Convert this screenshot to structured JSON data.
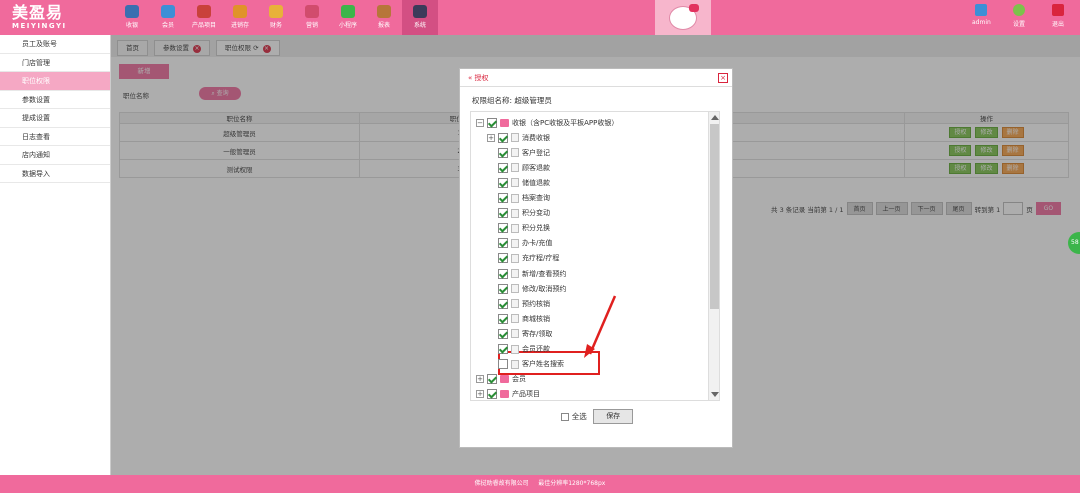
{
  "header": {
    "logo_cn": "美盈易",
    "logo_en": "MEIYINGYI",
    "nav": [
      {
        "label": "收银",
        "icon": "cashier-icon",
        "color": "#3a6fb0"
      },
      {
        "label": "会员",
        "icon": "member-icon",
        "color": "#3d8fd6"
      },
      {
        "label": "产品项目",
        "icon": "product-icon",
        "color": "#c9413b"
      },
      {
        "label": "进销存",
        "icon": "inventory-icon",
        "color": "#e0932a"
      },
      {
        "label": "财务",
        "icon": "finance-icon",
        "color": "#e8b23a"
      },
      {
        "label": "营销",
        "icon": "marketing-icon",
        "color": "#d14c6d"
      },
      {
        "label": "小程序",
        "icon": "miniprogram-icon",
        "color": "#3cb54a"
      },
      {
        "label": "报表",
        "icon": "report-icon",
        "color": "#b7763a"
      },
      {
        "label": "系统",
        "icon": "system-icon",
        "color": "#3b3b5a"
      }
    ],
    "user_label": "admin",
    "settings_label": "设置",
    "logout_label": "退出"
  },
  "sidebar": {
    "items": [
      {
        "label": "员工及账号",
        "active": false
      },
      {
        "label": "门店管理",
        "active": false
      },
      {
        "label": "职位权限",
        "active": true
      },
      {
        "label": "参数设置",
        "active": false
      },
      {
        "label": "提成设置",
        "active": false
      },
      {
        "label": "日志查看",
        "active": false
      },
      {
        "label": "店内通知",
        "active": false
      },
      {
        "label": "数据导入",
        "active": false
      }
    ]
  },
  "tabs": [
    {
      "label": "首页"
    },
    {
      "label": "参数设置"
    },
    {
      "label": "职位权限"
    }
  ],
  "main": {
    "add_button": "新增",
    "filter_label": "职位名称",
    "query_button": "查询",
    "table": {
      "headers": [
        "职位名称",
        "职位排",
        "操作"
      ],
      "rows": [
        [
          "超级管理员",
          "1"
        ],
        [
          "一般管理员",
          "2"
        ],
        [
          "测试权限",
          "3"
        ]
      ],
      "op_auth": "授权",
      "op_edit": "修改",
      "op_delete": "删除"
    },
    "pager": {
      "summary": "共 3 条记录 当前第 1 / 1",
      "first": "首页",
      "prev": "上一页",
      "next": "下一页",
      "last": "尾页",
      "goto_label": "转到第 1",
      "page_unit": "页",
      "go": "GO"
    }
  },
  "dialog": {
    "title": "« 授权",
    "group_line": "权限组名称: 超级管理员",
    "tree": [
      {
        "label": "收银（含PC收银及平板APP收银）",
        "level": 0,
        "checked": true,
        "expander": "−",
        "icon": "home"
      },
      {
        "label": "消费收银",
        "level": 1,
        "checked": true,
        "expander": "+",
        "icon": "file"
      },
      {
        "label": "客户登记",
        "level": 2,
        "checked": true,
        "expander": "",
        "icon": "file"
      },
      {
        "label": "顾客退款",
        "level": 2,
        "checked": true,
        "expander": "",
        "icon": "file"
      },
      {
        "label": "储值退款",
        "level": 2,
        "checked": true,
        "expander": "",
        "icon": "file"
      },
      {
        "label": "档案查询",
        "level": 2,
        "checked": true,
        "expander": "",
        "icon": "file"
      },
      {
        "label": "积分变动",
        "level": 2,
        "checked": true,
        "expander": "",
        "icon": "file"
      },
      {
        "label": "积分兑换",
        "level": 2,
        "checked": true,
        "expander": "",
        "icon": "file"
      },
      {
        "label": "办卡/充值",
        "level": 2,
        "checked": true,
        "expander": "",
        "icon": "file"
      },
      {
        "label": "充疗程/疗程",
        "level": 2,
        "checked": true,
        "expander": "",
        "icon": "file"
      },
      {
        "label": "新增/查看预约",
        "level": 2,
        "checked": true,
        "expander": "",
        "icon": "file"
      },
      {
        "label": "修改/取消预约",
        "level": 2,
        "checked": true,
        "expander": "",
        "icon": "file"
      },
      {
        "label": "预约核销",
        "level": 2,
        "checked": true,
        "expander": "",
        "icon": "file"
      },
      {
        "label": "商城核销",
        "level": 2,
        "checked": true,
        "expander": "",
        "icon": "file"
      },
      {
        "label": "寄存/领取",
        "level": 2,
        "checked": true,
        "expander": "",
        "icon": "file"
      },
      {
        "label": "会员还款",
        "level": 2,
        "checked": true,
        "expander": "",
        "icon": "file"
      },
      {
        "label": "客户姓名搜索",
        "level": 2,
        "checked": false,
        "expander": "",
        "icon": "file"
      },
      {
        "label": "会员",
        "level": 0,
        "checked": true,
        "expander": "+",
        "icon": "home"
      },
      {
        "label": "产品项目",
        "level": 0,
        "checked": true,
        "expander": "+",
        "icon": "home"
      }
    ],
    "select_all": "全选",
    "save": "保存"
  },
  "footer": {
    "company": "佛挝助睿故有限公司",
    "resolution": "最佳分辨率1280*768px"
  },
  "float_badge": "58",
  "colors": {
    "brand_pink": "#f06a9c",
    "active_nav": "#d34f83",
    "highlight_red": "#e0201f",
    "check_green": "#2a8d36"
  }
}
